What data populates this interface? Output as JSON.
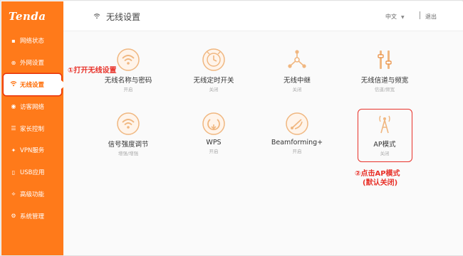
{
  "brand": {
    "logo_text": "Tenda"
  },
  "sidebar": {
    "items": [
      {
        "label": "网络状态",
        "icon": "network-status-icon",
        "glyph": "▪"
      },
      {
        "label": "外网设置",
        "icon": "wan-settings-icon",
        "glyph": "⊕"
      },
      {
        "label": "无线设置",
        "icon": "wifi-icon",
        "glyph": "ᯤ",
        "active": true
      },
      {
        "label": "访客网络",
        "icon": "guest-network-icon",
        "glyph": "◉"
      },
      {
        "label": "家长控制",
        "icon": "parental-control-icon",
        "glyph": "☰"
      },
      {
        "label": "VPN服务",
        "icon": "vpn-icon",
        "glyph": "✦"
      },
      {
        "label": "USB应用",
        "icon": "usb-icon",
        "glyph": "▯"
      },
      {
        "label": "高级功能",
        "icon": "advanced-icon",
        "glyph": "⟡"
      },
      {
        "label": "系统管理",
        "icon": "system-icon",
        "glyph": "⚙"
      }
    ]
  },
  "header": {
    "title": "无线设置",
    "language": "中文",
    "logout": "退出"
  },
  "tiles": [
    {
      "name": "无线名称与密码",
      "status": "开启",
      "icon": "wifi-password-icon"
    },
    {
      "name": "无线定时开关",
      "status": "关闭",
      "icon": "wifi-timer-icon"
    },
    {
      "name": "无线中继",
      "status": "关闭",
      "icon": "wireless-repeater-icon"
    },
    {
      "name": "无线信道与频宽",
      "status": "信道/频宽",
      "icon": "channel-bandwidth-icon"
    },
    {
      "name": "信号强度调节",
      "status": "增强/增强",
      "icon": "signal-strength-icon"
    },
    {
      "name": "WPS",
      "status": "开启",
      "icon": "wps-icon"
    },
    {
      "name": "Beamforming+",
      "status": "开启",
      "icon": "beamforming-icon"
    },
    {
      "name": "AP模式",
      "status": "关闭",
      "icon": "ap-mode-icon"
    }
  ],
  "annotations": {
    "step1": "①打开无线设置",
    "step2_line1": "②点击AP模式",
    "step2_line2": "(默认关闭)"
  },
  "colors": {
    "accent": "#ff7a1a",
    "annotation_red": "#e8322a",
    "icon_tint": "#f0b780"
  }
}
